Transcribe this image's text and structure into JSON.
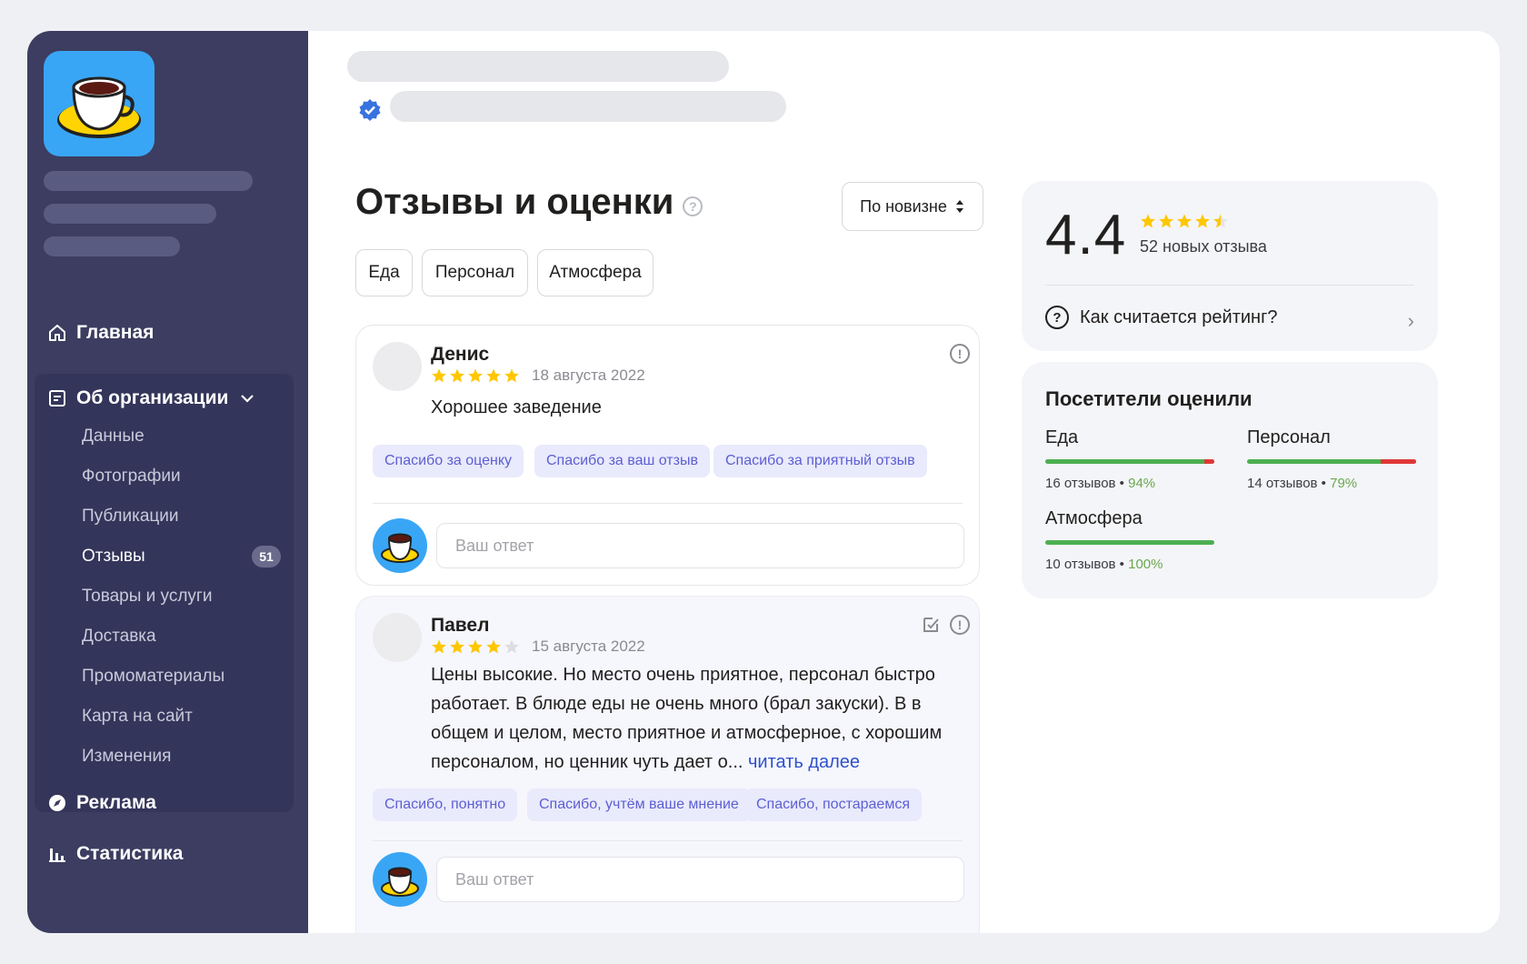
{
  "sidebar": {
    "home": "Главная",
    "about": {
      "label": "Об организации",
      "items": [
        {
          "label": "Данные"
        },
        {
          "label": "Фотографии"
        },
        {
          "label": "Публикации"
        },
        {
          "label": "Отзывы",
          "badge": "51",
          "active": true
        },
        {
          "label": "Товары и услуги"
        },
        {
          "label": "Доставка"
        },
        {
          "label": "Промоматериалы"
        },
        {
          "label": "Карта на сайт"
        },
        {
          "label": "Изменения"
        }
      ]
    },
    "ads": "Реклама",
    "stats": "Статистика"
  },
  "main": {
    "title": "Отзывы и оценки",
    "sort_label": "По новизне",
    "filters": [
      "Еда",
      "Персонал",
      "Атмосфера"
    ],
    "reviews": [
      {
        "author": "Денис",
        "date": "18 августа 2022",
        "rating": 5,
        "text": "Хорошее заведение",
        "quick_replies": [
          "Спасибо за оценку",
          "Спасибо за ваш отзыв",
          "Спасибо за приятный отзыв"
        ],
        "answer_placeholder": "Ваш ответ"
      },
      {
        "author": "Павел",
        "date": "15 августа 2022",
        "rating": 4,
        "text": "Цены высокие. Но место очень приятное, персонал быстро работает. В блюде еды не очень много (брал закуски). В в общем и целом, место приятное и атмосферное, с хорошим персоналом, но ценник чуть дает о...",
        "read_more": "читать далее",
        "quick_replies": [
          "Спасибо, понятно",
          "Спасибо, учтём ваше мнение",
          "Спасибо, постараемся"
        ],
        "answer_placeholder": "Ваш ответ"
      }
    ]
  },
  "rating_card": {
    "value": "4.4",
    "stars": 4.5,
    "new_reviews": "52 новых отзыва",
    "how_label": "Как считается рейтинг?"
  },
  "visitors": {
    "title": "Посетители оценили",
    "categories": [
      {
        "name": "Еда",
        "count": "16 отзывов",
        "percent": "94%",
        "value": 0.94
      },
      {
        "name": "Персонал",
        "count": "14 отзывов",
        "percent": "79%",
        "value": 0.79
      },
      {
        "name": "Атмосфера",
        "count": "10 отзывов",
        "percent": "100%",
        "value": 1.0
      }
    ]
  },
  "colors": {
    "sidebar": "#3c3d60",
    "accent_blue": "#2e51c9",
    "star": "#ffc700",
    "positive": "#4caf50",
    "negative": "#e03838"
  }
}
